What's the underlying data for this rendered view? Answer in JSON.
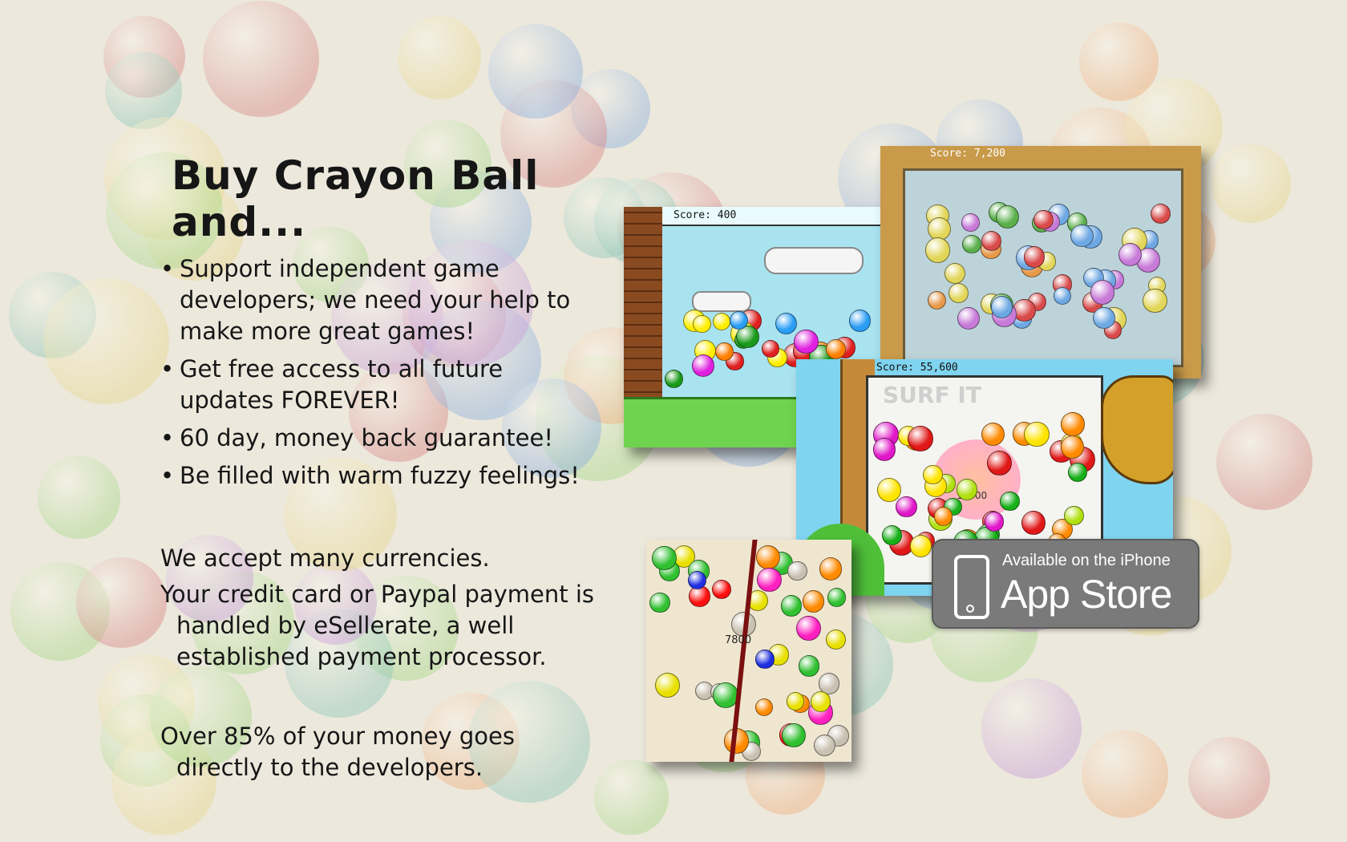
{
  "headline": "Buy Crayon Ball and...",
  "bullets": [
    {
      "line1": "Support independent game",
      "line2": "developers; we need your help to",
      "line3": "make more great games!"
    },
    {
      "line1": "Get free access to all future",
      "line2": "updates FOREVER!"
    },
    {
      "line1": "60 day, money back guarantee!"
    },
    {
      "line1": "Be filled with warm fuzzy feelings!"
    }
  ],
  "bullet_glyph": "•",
  "currency_line": "We accept many currencies.",
  "payment": {
    "line1": "Your credit card or Paypal payment is",
    "line2": "handled by eSellerate, a well",
    "line3": "established payment processor."
  },
  "developers": {
    "line1": "Over 85% of your money goes",
    "line2": "directly to the developers."
  },
  "screenshots": {
    "retro": {
      "score": "Score: 400"
    },
    "nature": {
      "score": "Score: 7,200"
    },
    "surf": {
      "score": "Score: 55,600",
      "banner": "SURF IT",
      "popup": "10500"
    },
    "crayon": {
      "popup": "7800"
    }
  },
  "app_store": {
    "line1": "Available on the iPhone",
    "line2": "App Store",
    "icon": "iphone-icon"
  },
  "colors": {
    "text": "#161616",
    "background": "#ece8dc",
    "badge": "#7a7a7a"
  }
}
